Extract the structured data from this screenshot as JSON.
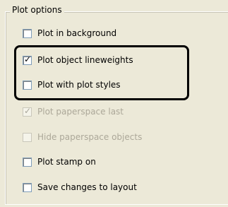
{
  "group": {
    "title": "Plot options"
  },
  "options": [
    {
      "label": "Plot in background",
      "checked": false,
      "enabled": true
    },
    {
      "label": "Plot object lineweights",
      "checked": true,
      "enabled": true
    },
    {
      "label": "Plot with plot styles",
      "checked": false,
      "enabled": true
    },
    {
      "label": "Plot paperspace last",
      "checked": true,
      "enabled": false
    },
    {
      "label": "Hide paperspace objects",
      "checked": false,
      "enabled": false
    },
    {
      "label": "Plot stamp on",
      "checked": false,
      "enabled": true
    },
    {
      "label": "Save changes to layout",
      "checked": false,
      "enabled": true
    }
  ],
  "checkmark_glyph": "✓",
  "colors": {
    "dialog_bg": "#ece9d8",
    "disabled_text": "#aca899",
    "highlight_border": "#000000"
  }
}
